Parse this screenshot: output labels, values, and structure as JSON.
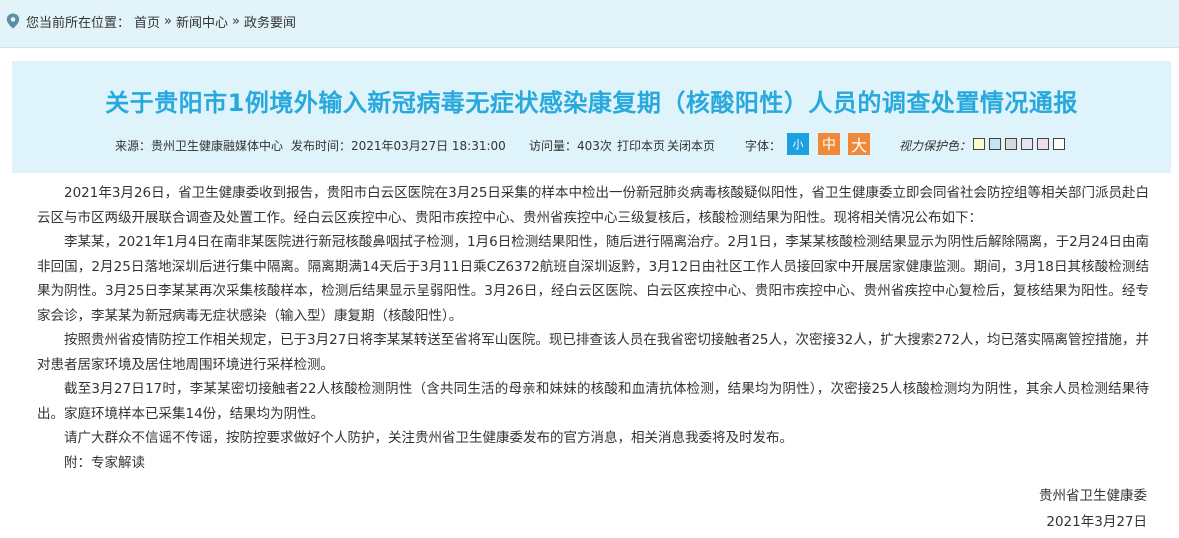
{
  "breadcrumb": {
    "prefix": "您当前所在位置：",
    "items": [
      "首页",
      "新闻中心",
      "政务要闻"
    ],
    "separator": "»"
  },
  "article": {
    "title": "关于贵阳市1例境外输入新冠病毒无症状感染康复期（核酸阳性）人员的调查处置情况通报",
    "meta": {
      "source": "来源：贵州卫生健康融媒体中心",
      "publish_time": "发布时间：2021年03月27日 18:31:00",
      "visits": "访问量：403次",
      "print": "打印本页",
      "close": "关闭本页",
      "font_label": "字体：",
      "font_sizes": [
        "小",
        "中",
        "大"
      ],
      "font_colors": [
        "#1ba1e2",
        "#f0883a",
        "#f0883a"
      ],
      "vision_label": "视力保护色：",
      "vision_colors": [
        "#fafad2",
        "#c6e5f0",
        "#d9d9d9",
        "#e5e5f5",
        "#f2dcee",
        "#fcfcfc"
      ]
    },
    "paragraphs": [
      "2021年3月26日，省卫生健康委收到报告，贵阳市白云区医院在3月25日采集的样本中检出一份新冠肺炎病毒核酸疑似阳性，省卫生健康委立即会同省社会防控组等相关部门派员赴白云区与市区两级开展联合调查及处置工作。经白云区疾控中心、贵阳市疾控中心、贵州省疾控中心三级复核后，核酸检测结果为阳性。现将相关情况公布如下：",
      "李某某，2021年1月4日在南非某医院进行新冠核酸鼻咽拭子检测，1月6日检测结果阳性，随后进行隔离治疗。2月1日，李某某核酸检测结果显示为阴性后解除隔离，于2月24日由南非回国，2月25日落地深圳后进行集中隔离。隔离期满14天后于3月11日乘CZ6372航班自深圳返黔，3月12日由社区工作人员接回家中开展居家健康监测。期间，3月18日其核酸检测结果为阴性。3月25日李某某再次采集核酸样本，检测后结果显示呈弱阳性。3月26日，经白云区医院、白云区疾控中心、贵阳市疾控中心、贵州省疾控中心复检后，复核结果为阳性。经专家会诊，李某某为新冠病毒无症状感染（输入型）康复期（核酸阳性）。",
      "按照贵州省疫情防控工作相关规定，已于3月27日将李某某转送至省将军山医院。现已排查该人员在我省密切接触者25人，次密接32人，扩大搜索272人，均已落实隔离管控措施，并对患者居家环境及居住地周围环境进行采样检测。",
      "截至3月27日17时，李某某密切接触者22人核酸检测阴性（含共同生活的母亲和妹妹的核酸和血清抗体检测，结果均为阴性），次密接25人核酸检测均为阴性，其余人员检测结果待出。家庭环境样本已采集14份，结果均为阴性。",
      "请广大群众不信谣不传谣，按防控要求做好个人防护，关注贵州省卫生健康委发布的官方消息，相关消息我委将及时发布。",
      "附：专家解读"
    ],
    "signature": {
      "org": "贵州省卫生健康委",
      "date": "2021年3月27日"
    }
  }
}
